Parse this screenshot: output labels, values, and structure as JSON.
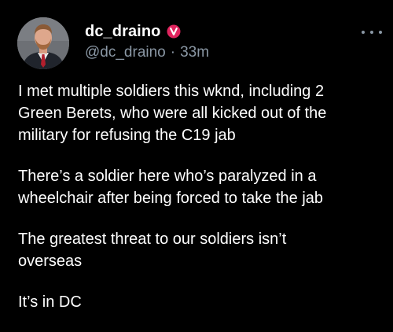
{
  "user": {
    "display_name": "dc_draino",
    "handle": "@dc_draino",
    "separator": "·",
    "timestamp": "33m",
    "verified_icon": "verified-badge-icon",
    "verified_color": "#e0245e"
  },
  "post": {
    "paragraphs": [
      "I met multiple soldiers this wknd, including 2\nGreen Berets, who were all kicked out of the\nmilitary for refusing the C19 jab",
      "There’s a soldier here who’s paralyzed in a\nwheelchair after being forced to take the jab",
      "The greatest threat to our soldiers isn’t\noverseas",
      "It’s in DC"
    ]
  },
  "menu": {
    "icon": "more-options-icon"
  },
  "colors": {
    "background": "#000000",
    "text": "#ffffff",
    "secondary_text": "#8b98a5"
  }
}
